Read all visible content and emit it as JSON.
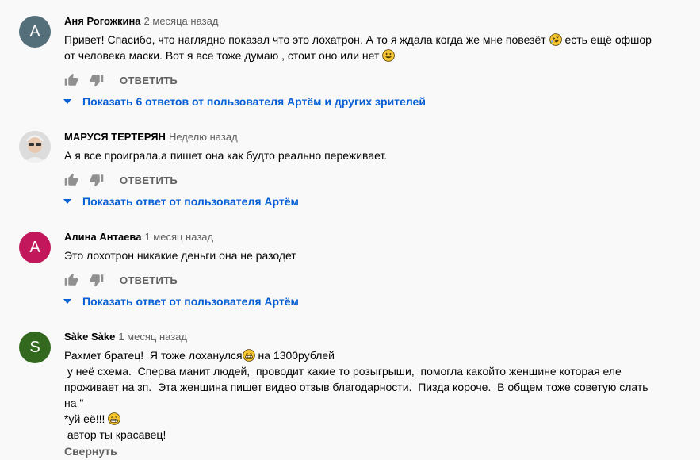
{
  "colors": {
    "avatar_a1": "#546e7a",
    "avatar_a2": "#c2185b",
    "avatar_s": "#33691e",
    "link": "#065fd4",
    "meta": "#606060"
  },
  "comments": [
    {
      "avatar_letter": "А",
      "author": "Аня Рогожкина",
      "time": "2 месяца назад",
      "line1": "Привет! Спасибо, что наглядно показал что это лохатрон. А то я ждала когда же мне повезёт",
      "line1b": " есть ещё офшор",
      "line2": "от человека маски. Вот я все тоже думаю , стоит оно или нет ",
      "reply_label": "ОТВЕТИТЬ",
      "replies_label": "Показать 6 ответов от пользователя Артём и других зрителей"
    },
    {
      "author": "МАРУСЯ ТЕРТЕРЯН",
      "time": "Неделю назад",
      "line1": "А я все проиграла.а пишет она как будто реально переживает.",
      "reply_label": "ОТВЕТИТЬ",
      "replies_label": "Показать ответ от пользователя Артём"
    },
    {
      "avatar_letter": "А",
      "author": "Алина Антаева",
      "time": "1 месяц назад",
      "line1": "Это лохотрон никакие деньги она не разодет",
      "reply_label": "ОТВЕТИТЬ",
      "replies_label": "Показать ответ от пользователя Артём"
    },
    {
      "avatar_letter": "S",
      "author": "Sàke Sàke",
      "time": "1 месяц назад",
      "line1a": "Рахмет братец!  Я тоже лоханулся",
      "line1b": " на 1300рублей",
      "line2": " у неё схема.  Сперва манит людей,  проводит какие то розыгрыши,  помогла какойто женщине которая еле",
      "line3": "проживает на зп.  Эта женщина пишет видео отзыв благодарности.  Пизда короче.  В общем тоже советую слать",
      "line4": "на \"",
      "line5": "*уй её!!! ",
      "line6": " автор ты красавец!",
      "collapse_label": "Свернуть"
    }
  ]
}
